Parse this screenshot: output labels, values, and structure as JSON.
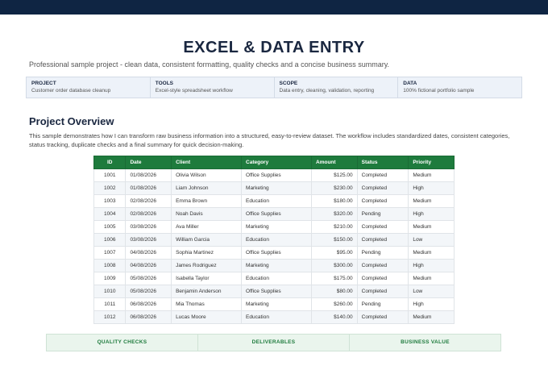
{
  "header": {
    "title": "EXCEL & DATA ENTRY",
    "subtitle": "Professional sample project - clean data, consistent formatting, quality checks and a concise business summary."
  },
  "info": [
    {
      "label": "PROJECT",
      "value": "Customer order database cleanup"
    },
    {
      "label": "TOOLS",
      "value": "Excel-style spreadsheet workflow"
    },
    {
      "label": "SCOPE",
      "value": "Data entry, cleaning, validation, reporting"
    },
    {
      "label": "DATA",
      "value": "100% fictional portfolio sample"
    }
  ],
  "overview": {
    "title": "Project Overview",
    "text": "This sample demonstrates how I can transform raw business information into a structured, easy-to-review dataset. The workflow includes standardized dates, consistent categories, status tracking, duplicate checks and a final summary for quick decision-making."
  },
  "table": {
    "headers": [
      "ID",
      "Date",
      "Client",
      "Category",
      "Amount",
      "Status",
      "Priority"
    ],
    "rows": [
      [
        "1001",
        "01/08/2026",
        "Olivia Wilson",
        "Office Supplies",
        "$125.00",
        "Completed",
        "Medium"
      ],
      [
        "1002",
        "01/08/2026",
        "Liam Johnson",
        "Marketing",
        "$230.00",
        "Completed",
        "High"
      ],
      [
        "1003",
        "02/08/2026",
        "Emma Brown",
        "Education",
        "$180.00",
        "Completed",
        "Medium"
      ],
      [
        "1004",
        "02/08/2026",
        "Noah Davis",
        "Office Supplies",
        "$320.00",
        "Pending",
        "High"
      ],
      [
        "1005",
        "03/08/2026",
        "Ava Miller",
        "Marketing",
        "$210.00",
        "Completed",
        "Medium"
      ],
      [
        "1006",
        "03/08/2026",
        "William Garcia",
        "Education",
        "$150.00",
        "Completed",
        "Low"
      ],
      [
        "1007",
        "04/08/2026",
        "Sophia Martinez",
        "Office Supplies",
        "$95.00",
        "Pending",
        "Medium"
      ],
      [
        "1008",
        "04/08/2026",
        "James Rodriguez",
        "Marketing",
        "$300.00",
        "Completed",
        "High"
      ],
      [
        "1009",
        "05/08/2026",
        "Isabella Taylor",
        "Education",
        "$175.00",
        "Completed",
        "Medium"
      ],
      [
        "1010",
        "05/08/2026",
        "Benjamin Anderson",
        "Office Supplies",
        "$80.00",
        "Completed",
        "Low"
      ],
      [
        "1011",
        "06/08/2026",
        "Mia Thomas",
        "Marketing",
        "$260.00",
        "Pending",
        "High"
      ],
      [
        "1012",
        "06/08/2026",
        "Lucas Moore",
        "Education",
        "$140.00",
        "Completed",
        "Medium"
      ]
    ]
  },
  "bottom": [
    "QUALITY CHECKS",
    "DELIVERABLES",
    "BUSINESS VALUE"
  ],
  "colors": {
    "topbar": "#0f2543",
    "table_header": "#1e7b3d",
    "title": "#1a2740"
  }
}
